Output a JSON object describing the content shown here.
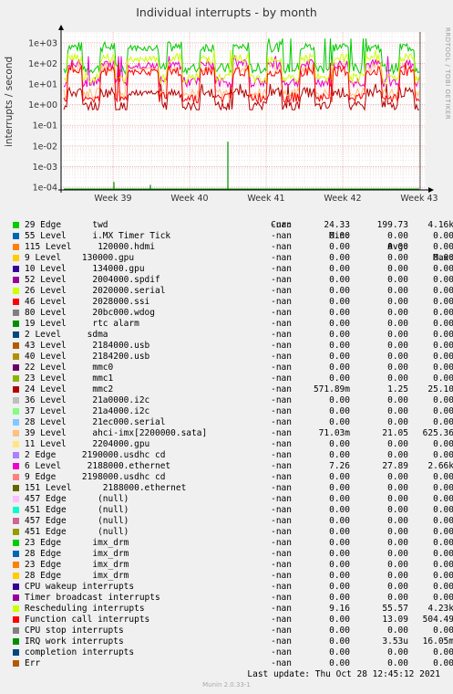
{
  "title": "Individual interrupts - by month",
  "side_label": "RRDTOOL / TOBI OETIKER",
  "footer": {
    "last_update": "Last update:  Thu Oct 28 12:45:12 2021",
    "munin": "Munin 2.0.33-1"
  },
  "legend_headers": {
    "cur": "Cur:",
    "min": "Min:",
    "avg": "Avg:",
    "max": "Max:"
  },
  "chart_data": {
    "type": "line",
    "title": "Individual interrupts - by month",
    "ylabel": "interrupts / second",
    "yscale": "log",
    "ylim": [
      5e-05,
      3000
    ],
    "yticks": [
      "1e-04",
      "1e-03",
      "1e-02",
      "1e-01",
      "1e+00",
      "1e+01",
      "1e+02",
      "1e+03"
    ],
    "xticks": [
      "Week 39",
      "Week 40",
      "Week 41",
      "Week 42",
      "Week 43"
    ],
    "grid": true,
    "series": [
      {
        "name": "29 Edge      twd",
        "color": "#00cc00",
        "cur": "-nan",
        "min": "24.33",
        "avg": "199.73",
        "max": "4.16k"
      },
      {
        "name": "55 Level     i.MX Timer Tick",
        "color": "#0066b3",
        "cur": "-nan",
        "min": "0.00",
        "avg": "0.00",
        "max": "0.00"
      },
      {
        "name": "115 Level     120000.hdmi",
        "color": "#ff8000",
        "cur": "-nan",
        "min": "0.00",
        "avg": "0.00",
        "max": "0.00"
      },
      {
        "name": "9 Level    130000.gpu",
        "color": "#ffcc00",
        "cur": "-nan",
        "min": "0.00",
        "avg": "0.00",
        "max": "0.00"
      },
      {
        "name": "10 Level     134000.gpu",
        "color": "#330099",
        "cur": "-nan",
        "min": "0.00",
        "avg": "0.00",
        "max": "0.00"
      },
      {
        "name": "52 Level     2004000.spdif",
        "color": "#990099",
        "cur": "-nan",
        "min": "0.00",
        "avg": "0.00",
        "max": "0.00"
      },
      {
        "name": "26 Level     2020000.serial",
        "color": "#ccff00",
        "cur": "-nan",
        "min": "0.00",
        "avg": "0.00",
        "max": "0.00"
      },
      {
        "name": "46 Level     2028000.ssi",
        "color": "#ff0000",
        "cur": "-nan",
        "min": "0.00",
        "avg": "0.00",
        "max": "0.00"
      },
      {
        "name": "80 Level     20bc000.wdog",
        "color": "#808080",
        "cur": "-nan",
        "min": "0.00",
        "avg": "0.00",
        "max": "0.00"
      },
      {
        "name": "19 Level     rtc alarm",
        "color": "#008f00",
        "cur": "-nan",
        "min": "0.00",
        "avg": "0.00",
        "max": "0.00"
      },
      {
        "name": "2 Level     sdma",
        "color": "#00487d",
        "cur": "-nan",
        "min": "0.00",
        "avg": "0.00",
        "max": "0.00"
      },
      {
        "name": "43 Level     2184000.usb",
        "color": "#b35a00",
        "cur": "-nan",
        "min": "0.00",
        "avg": "0.00",
        "max": "0.00"
      },
      {
        "name": "40 Level     2184200.usb",
        "color": "#b38f00",
        "cur": "-nan",
        "min": "0.00",
        "avg": "0.00",
        "max": "0.00"
      },
      {
        "name": "22 Level     mmc0",
        "color": "#6b006b",
        "cur": "-nan",
        "min": "0.00",
        "avg": "0.00",
        "max": "0.00"
      },
      {
        "name": "23 Level     mmc1",
        "color": "#8fb300",
        "cur": "-nan",
        "min": "0.00",
        "avg": "0.00",
        "max": "0.00"
      },
      {
        "name": "24 Level     mmc2",
        "color": "#b30000",
        "cur": "-nan",
        "min": "571.89m",
        "avg": "1.25",
        "max": "25.10"
      },
      {
        "name": "36 Level     21a0000.i2c",
        "color": "#bebebe",
        "cur": "-nan",
        "min": "0.00",
        "avg": "0.00",
        "max": "0.00"
      },
      {
        "name": "37 Level     21a4000.i2c",
        "color": "#80ff80",
        "cur": "-nan",
        "min": "0.00",
        "avg": "0.00",
        "max": "0.00"
      },
      {
        "name": "28 Level     21ec000.serial",
        "color": "#80c9ff",
        "cur": "-nan",
        "min": "0.00",
        "avg": "0.00",
        "max": "0.00"
      },
      {
        "name": "39 Level     ahci-imx[2200000.sata]",
        "color": "#ffc080",
        "cur": "-nan",
        "min": "71.03m",
        "avg": "21.05",
        "max": "625.36"
      },
      {
        "name": "11 Level     2204000.gpu",
        "color": "#ffe680",
        "cur": "-nan",
        "min": "0.00",
        "avg": "0.00",
        "max": "0.00"
      },
      {
        "name": "2 Edge     2190000.usdhc cd",
        "color": "#aa80ff",
        "cur": "-nan",
        "min": "0.00",
        "avg": "0.00",
        "max": "0.00"
      },
      {
        "name": "6 Level     2188000.ethernet",
        "color": "#ee00cc",
        "cur": "-nan",
        "min": "7.26",
        "avg": "27.89",
        "max": "2.66k"
      },
      {
        "name": "9 Edge     2198000.usdhc cd",
        "color": "#ff8080",
        "cur": "-nan",
        "min": "0.00",
        "avg": "0.00",
        "max": "0.00"
      },
      {
        "name": "151 Level      2188000.ethernet",
        "color": "#666600",
        "cur": "-nan",
        "min": "0.00",
        "avg": "0.00",
        "max": "0.00"
      },
      {
        "name": "457 Edge      (null)",
        "color": "#ffbfff",
        "cur": "-nan",
        "min": "0.00",
        "avg": "0.00",
        "max": "0.00"
      },
      {
        "name": "451 Edge      (null)",
        "color": "#00ffcc",
        "cur": "-nan",
        "min": "0.00",
        "avg": "0.00",
        "max": "0.00"
      },
      {
        "name": "457 Edge      (null)",
        "color": "#cc6699",
        "cur": "-nan",
        "min": "0.00",
        "avg": "0.00",
        "max": "0.00"
      },
      {
        "name": "451 Edge      (null)",
        "color": "#999900",
        "cur": "-nan",
        "min": "0.00",
        "avg": "0.00",
        "max": "0.00"
      },
      {
        "name": "23 Edge      imx_drm",
        "color": "#00cc00",
        "cur": "-nan",
        "min": "0.00",
        "avg": "0.00",
        "max": "0.00"
      },
      {
        "name": "28 Edge      imx_drm",
        "color": "#0066b3",
        "cur": "-nan",
        "min": "0.00",
        "avg": "0.00",
        "max": "0.00"
      },
      {
        "name": "23 Edge      imx_drm",
        "color": "#ff8000",
        "cur": "-nan",
        "min": "0.00",
        "avg": "0.00",
        "max": "0.00"
      },
      {
        "name": "28 Edge      imx_drm",
        "color": "#ffcc00",
        "cur": "-nan",
        "min": "0.00",
        "avg": "0.00",
        "max": "0.00"
      },
      {
        "name": "CPU wakeup interrupts",
        "color": "#330099",
        "cur": "-nan",
        "min": "0.00",
        "avg": "0.00",
        "max": "0.00"
      },
      {
        "name": "Timer broadcast interrupts",
        "color": "#990099",
        "cur": "-nan",
        "min": "0.00",
        "avg": "0.00",
        "max": "0.00"
      },
      {
        "name": "Rescheduling interrupts",
        "color": "#ccff00",
        "cur": "-nan",
        "min": "9.16",
        "avg": "55.57",
        "max": "4.23k"
      },
      {
        "name": "Function call interrupts",
        "color": "#ff0000",
        "cur": "-nan",
        "min": "0.00",
        "avg": "13.09",
        "max": "504.49"
      },
      {
        "name": "CPU stop interrupts",
        "color": "#808080",
        "cur": "-nan",
        "min": "0.00",
        "avg": "0.00",
        "max": "0.00"
      },
      {
        "name": "IRQ work interrupts",
        "color": "#008f00",
        "cur": "-nan",
        "min": "0.00",
        "avg": "3.53u",
        "max": "16.05m"
      },
      {
        "name": "completion interrupts",
        "color": "#00487d",
        "cur": "-nan",
        "min": "0.00",
        "avg": "0.00",
        "max": "0.00"
      },
      {
        "name": "Err",
        "color": "#b35a00",
        "cur": "-nan",
        "min": "0.00",
        "avg": "0.00",
        "max": "0.00"
      }
    ]
  }
}
